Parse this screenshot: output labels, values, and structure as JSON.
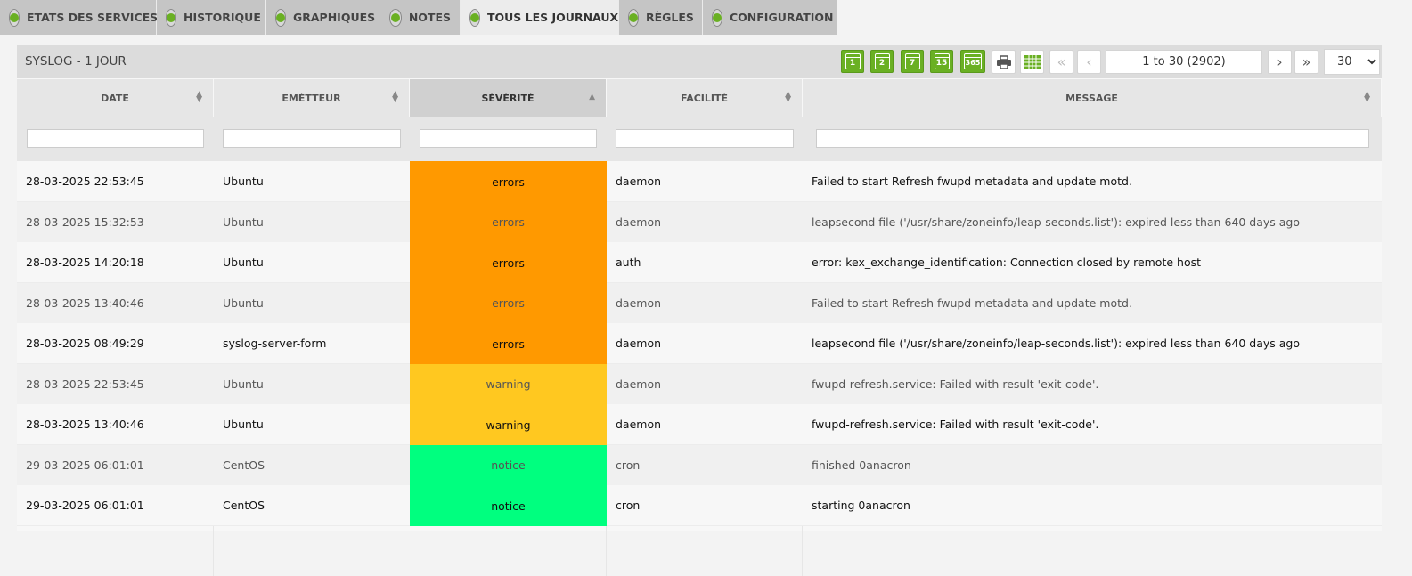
{
  "tabs": [
    {
      "label": "ETATS DES SERVICES",
      "icon": "pulse-icon",
      "active": false
    },
    {
      "label": "HISTORIQUE",
      "icon": "clock-icon",
      "active": false
    },
    {
      "label": "GRAPHIQUES",
      "icon": "bar-chart-icon",
      "active": false
    },
    {
      "label": "NOTES",
      "icon": "pencil-icon",
      "active": false
    },
    {
      "label": "TOUS LES JOURNAUX",
      "icon": "globe-icon",
      "active": true
    },
    {
      "label": "RÈGLES",
      "icon": "rules-icon",
      "active": false
    },
    {
      "label": "CONFIGURATION",
      "icon": "config-icon",
      "active": false
    }
  ],
  "panel": {
    "title": "SYSLOG - 1 JOUR",
    "calendar_buttons": [
      "1",
      "2",
      "7",
      "15",
      "365"
    ],
    "pager": {
      "text": "1 to 30 (2902)",
      "page_size": "30"
    }
  },
  "columns": [
    {
      "label": "DATE"
    },
    {
      "label": "EMÉTTEUR"
    },
    {
      "label": "SÉVÉRITÉ"
    },
    {
      "label": "FACILITÉ"
    },
    {
      "label": "MESSAGE"
    }
  ],
  "colors": {
    "errors": "#ff9900",
    "warning": "#ffc820",
    "notice": "#00ff7f",
    "accent": "#6ab023"
  },
  "rows": [
    {
      "date": "28-03-2025 22:53:45",
      "emitter": "Ubuntu",
      "severity": "errors",
      "facility": "daemon",
      "message": "Failed to start Refresh fwupd metadata and update motd."
    },
    {
      "date": "28-03-2025 15:32:53",
      "emitter": "Ubuntu",
      "severity": "errors",
      "facility": "daemon",
      "message": "leapsecond file ('/usr/share/zoneinfo/leap-seconds.list'): expired less than 640 days ago"
    },
    {
      "date": "28-03-2025 14:20:18",
      "emitter": "Ubuntu",
      "severity": "errors",
      "facility": "auth",
      "message": "error: kex_exchange_identification: Connection closed by remote host"
    },
    {
      "date": "28-03-2025 13:40:46",
      "emitter": "Ubuntu",
      "severity": "errors",
      "facility": "daemon",
      "message": "Failed to start Refresh fwupd metadata and update motd."
    },
    {
      "date": "28-03-2025 08:49:29",
      "emitter": "syslog-server-form",
      "severity": "errors",
      "facility": "daemon",
      "message": "leapsecond file ('/usr/share/zoneinfo/leap-seconds.list'): expired less than 640 days ago"
    },
    {
      "date": "28-03-2025 22:53:45",
      "emitter": "Ubuntu",
      "severity": "warning",
      "facility": "daemon",
      "message": "fwupd-refresh.service: Failed with result 'exit-code'."
    },
    {
      "date": "28-03-2025 13:40:46",
      "emitter": "Ubuntu",
      "severity": "warning",
      "facility": "daemon",
      "message": "fwupd-refresh.service: Failed with result 'exit-code'."
    },
    {
      "date": "29-03-2025 06:01:01",
      "emitter": "CentOS",
      "severity": "notice",
      "facility": "cron",
      "message": "finished 0anacron"
    },
    {
      "date": "29-03-2025 06:01:01",
      "emitter": "CentOS",
      "severity": "notice",
      "facility": "cron",
      "message": "starting 0anacron"
    }
  ]
}
